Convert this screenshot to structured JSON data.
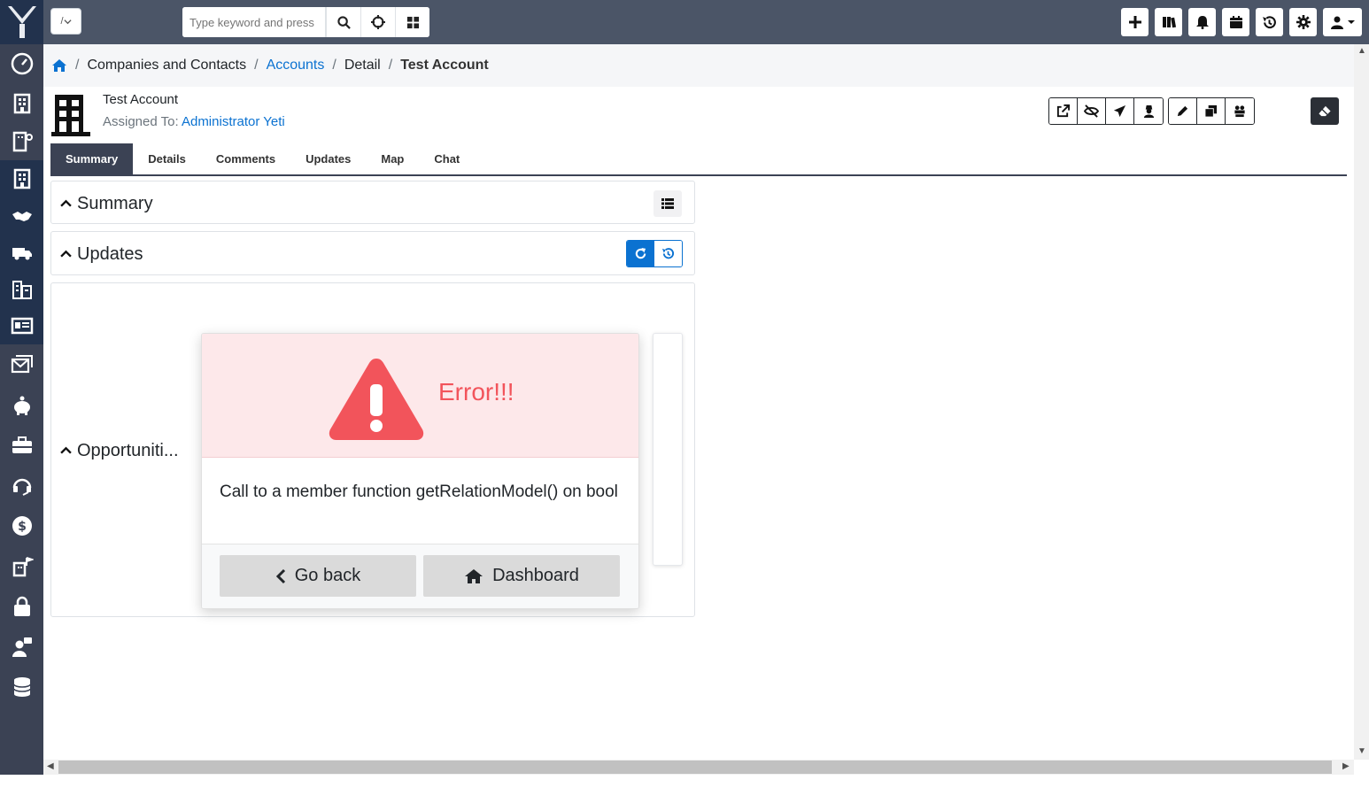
{
  "topbar": {
    "menu_toggle_label": "/",
    "search_placeholder": "Type keyword and press"
  },
  "breadcrumb": {
    "items": [
      "Companies and Contacts",
      "Accounts",
      "Detail",
      "Test Account"
    ]
  },
  "record": {
    "name": "Test Account",
    "assigned_label": "Assigned To:",
    "assigned_user": "Administrator Yeti"
  },
  "tabs": [
    "Summary",
    "Details",
    "Comments",
    "Updates",
    "Map",
    "Chat"
  ],
  "active_tab": "Summary",
  "panels": {
    "summary": "Summary",
    "updates": "Updates",
    "opportunities": "Opportuniti..."
  },
  "error": {
    "title": "Error!!!",
    "message": "Call to a member function getRelationModel() on bool",
    "go_back": "Go back",
    "dashboard": "Dashboard"
  },
  "colors": {
    "sidebar": "#3b4254",
    "topbar": "#4b5567",
    "link": "#0b72d1",
    "error": "#f2545b",
    "error_bg": "#fde8ea"
  },
  "icons": {
    "sidebar": [
      "dashboard-icon",
      "building-icon",
      "building-user-icon",
      "building-icon",
      "handshake-icon",
      "truck-icon",
      "city-icon",
      "id-card-icon",
      "envelopes-icon",
      "piggy-bank-icon",
      "briefcase-icon",
      "headset-icon",
      "dollar-icon",
      "building-flag-icon",
      "lock-icon",
      "user-message-icon",
      "database-icon"
    ],
    "top_right": [
      "plus-icon",
      "book-icon",
      "bell-icon",
      "calendar-icon",
      "history-icon",
      "gear-icon",
      "user-icon"
    ]
  }
}
